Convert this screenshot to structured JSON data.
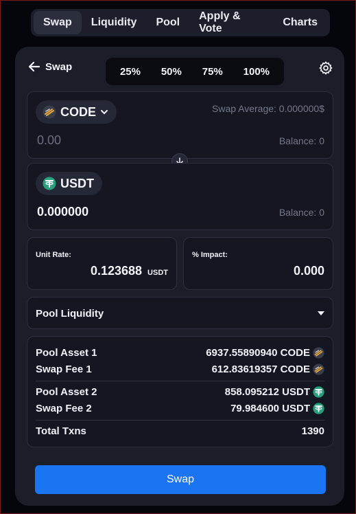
{
  "nav": {
    "items": [
      {
        "label": "Swap"
      },
      {
        "label": "Liquidity"
      },
      {
        "label": "Pool"
      },
      {
        "label": "Apply & Vote"
      },
      {
        "label": "Charts"
      }
    ],
    "active_index": 0
  },
  "header": {
    "back_label": "Swap",
    "percent_options": [
      "25%",
      "50%",
      "75%",
      "100%"
    ]
  },
  "from": {
    "token": "CODE",
    "swap_average": "Swap Average: 0.000000$",
    "amount_placeholder": "0.00",
    "balance": "Balance: 0"
  },
  "to": {
    "token": "USDT",
    "amount": "0.000000",
    "balance": "Balance: 0"
  },
  "unit_rate": {
    "label": "Unit Rate:",
    "value": "0.123688",
    "unit": "USDT"
  },
  "impact": {
    "label": "% Impact:",
    "value": "0.000"
  },
  "pool_liquidity": {
    "label": "Pool Liquidity"
  },
  "pool_stats": {
    "asset1_label": "Pool Asset 1",
    "asset1_value": "6937.55890940 CODE",
    "fee1_label": "Swap Fee 1",
    "fee1_value": "612.83619357 CODE",
    "asset2_label": "Pool Asset 2",
    "asset2_value": "858.095212 USDT",
    "fee2_label": "Swap Fee 2",
    "fee2_value": "79.984600 USDT",
    "txns_label": "Total Txns",
    "txns_value": "1390"
  },
  "swap_button": {
    "label": "Swap"
  },
  "colors": {
    "accent": "#1b74f2",
    "usdt": "#26a17b",
    "code_gold": "#e8a93a"
  }
}
